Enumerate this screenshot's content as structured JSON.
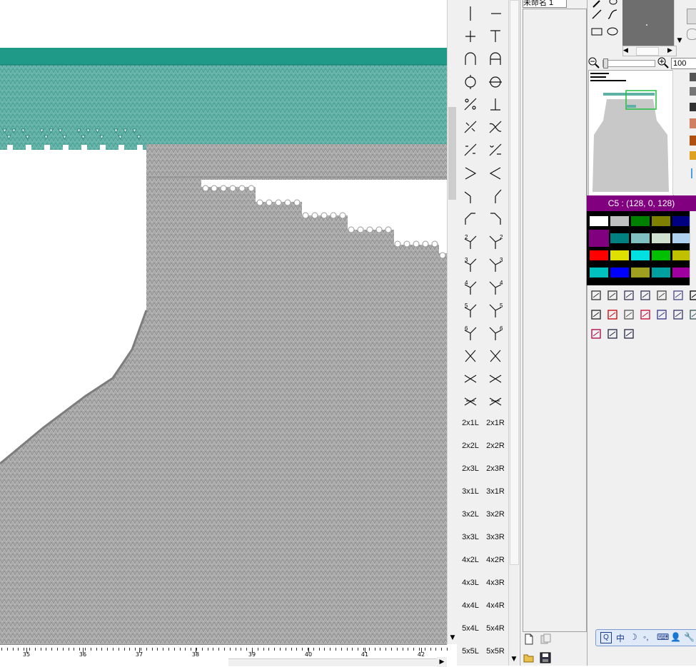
{
  "layer_panel": {
    "tab_label": "未命名 1"
  },
  "ruler": {
    "labels": [
      "35",
      "36",
      "37",
      "38",
      "39",
      "40",
      "41",
      "42"
    ]
  },
  "stitch_palette": {
    "cable_labels": [
      [
        "2x1L",
        "2x1R"
      ],
      [
        "2x2L",
        "2x2R"
      ],
      [
        "2x3L",
        "2x3R"
      ],
      [
        "3x1L",
        "3x1R"
      ],
      [
        "3x2L",
        "3x2R"
      ],
      [
        "3x3L",
        "3x3R"
      ],
      [
        "4x2L",
        "4x2R"
      ],
      [
        "4x3L",
        "4x3R"
      ],
      [
        "4x4L",
        "4x4R"
      ],
      [
        "5x4L",
        "5x4R"
      ],
      [
        "5x5L",
        "5x5R"
      ]
    ],
    "icons": [
      "knit-icon",
      "purl-icon",
      "cross-icon",
      "tuck-icon",
      "loop-up-icon",
      "loop-down-icon",
      "circle-line-icon",
      "circle-cross-icon",
      "decrease-left-icon",
      "bind-off-icon",
      "move-left-icon",
      "move-right-icon",
      "transfer-left-icon",
      "transfer-right-icon",
      "greater-icon",
      "less-icon",
      "fork-left-icon",
      "fork-right-icon",
      "bend-left-icon",
      "bend-right-icon"
    ]
  },
  "zoom": {
    "value": "100"
  },
  "color_panel": {
    "title": "C5 : (128, 0, 128)",
    "swatches": [
      "#ffffff",
      "#c0c0c0",
      "#008000",
      "#808000",
      "#000080",
      "#800080",
      "#008080",
      "#80c0c0",
      "#d0e0d0",
      "#b0d0f0",
      "#ff0000",
      "#e0e000",
      "#00e0e0",
      "#00c000",
      "#c0c000",
      "#00c0c0",
      "#0000ff",
      "#a0a020",
      "#00a0a0",
      "#a000a0"
    ],
    "selected": "#800080"
  },
  "ime_bar": {
    "items": [
      "中",
      "☽",
      "◦,",
      "⌨",
      "👤",
      "🔧"
    ]
  },
  "colors": {
    "knit_gray": "#a8a8a8",
    "knit_teal": "#5fb0a5",
    "dark_teal": "#1f9a88"
  }
}
